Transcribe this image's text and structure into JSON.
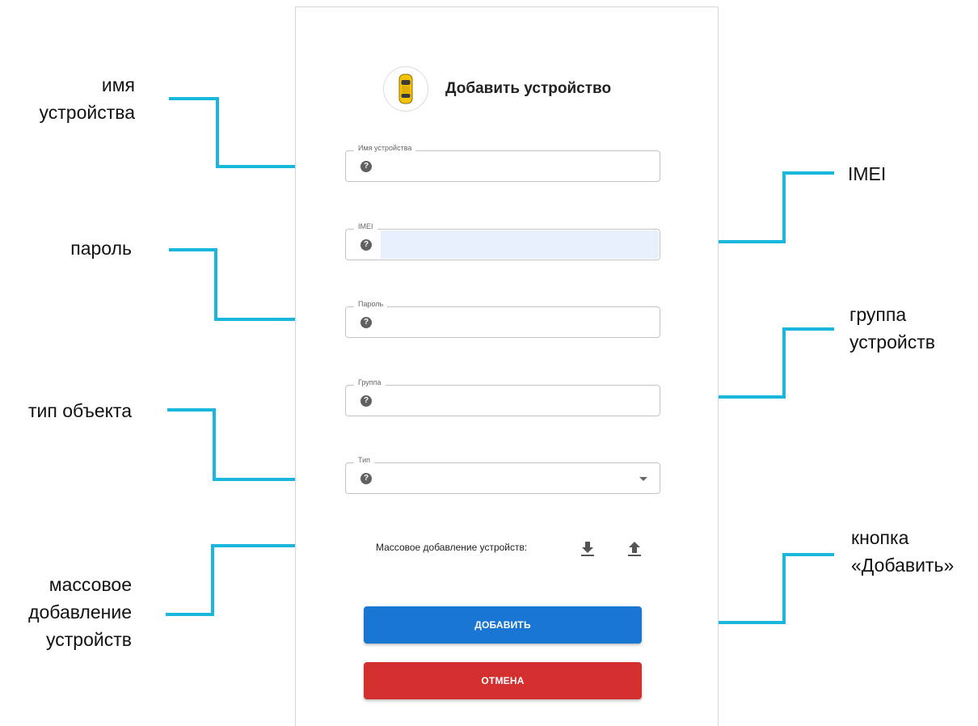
{
  "dialog": {
    "title": "Добавить устройство",
    "header_icon": "car-icon"
  },
  "fields": {
    "name": {
      "label": "Имя устройства",
      "value": ""
    },
    "imei": {
      "label": "IMEI",
      "value": ""
    },
    "password": {
      "label": "Пароль",
      "value": ""
    },
    "group": {
      "label": "Группа",
      "value": ""
    },
    "type": {
      "label": "Тип",
      "value": ""
    },
    "help_icon": "?"
  },
  "bulk": {
    "label": "Массовое добавление устройств:",
    "download_icon": "download-icon",
    "upload_icon": "upload-icon"
  },
  "buttons": {
    "add": "ДОБАВИТЬ",
    "cancel": "ОТМЕНА"
  },
  "callouts": {
    "device_name": [
      "имя",
      "устройства"
    ],
    "imei": [
      "IMEI"
    ],
    "password": [
      "пароль"
    ],
    "group": [
      "группа",
      "устройств"
    ],
    "object_type": [
      "тип объекта"
    ],
    "bulk_add": [
      "массовое",
      "добавление",
      "устройств"
    ],
    "add_button": [
      "кнопка",
      "«Добавить»"
    ]
  },
  "colors": {
    "callout_line": "#1ab7dd",
    "add_button": "#1976d2",
    "cancel_button": "#d32f2f",
    "autofill": "#e8f0fe"
  }
}
